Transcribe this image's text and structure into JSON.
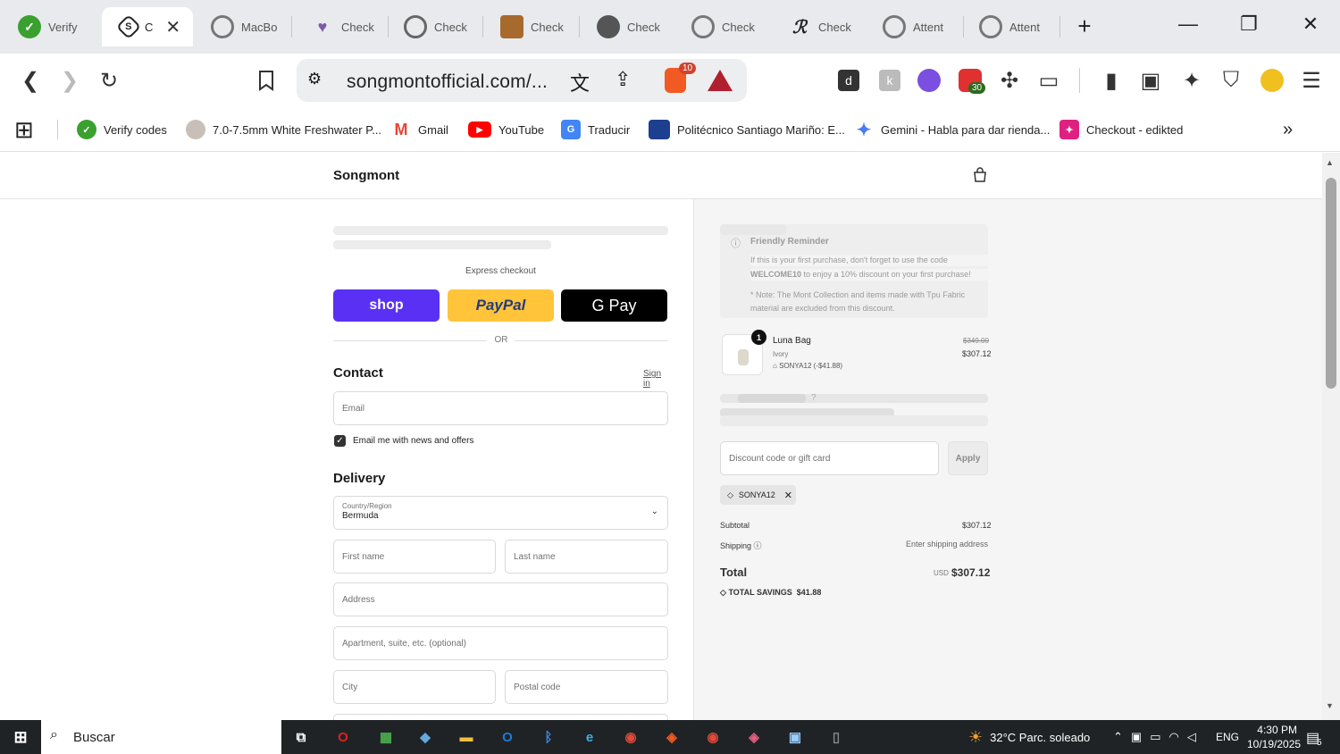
{
  "tabs": [
    {
      "label": "Verify",
      "icon": "verify-icon"
    },
    {
      "label": "C",
      "icon": "compass-icon",
      "active": true
    },
    {
      "label": "MacBo",
      "icon": "globe-icon"
    },
    {
      "label": "Check",
      "icon": "heart-icon"
    },
    {
      "label": "Check",
      "icon": "globe-icon"
    },
    {
      "label": "Check",
      "icon": "bag-icon"
    },
    {
      "label": "Check",
      "icon": "globe-icon"
    },
    {
      "label": "Check",
      "icon": "globe-icon"
    },
    {
      "label": "Check",
      "icon": "signature-icon"
    },
    {
      "label": "Attent",
      "icon": "globe-icon"
    },
    {
      "label": "Attent",
      "icon": "globe-icon"
    }
  ],
  "toolbar": {
    "url": "songmontofficial.com/...",
    "brave_badge": "10",
    "ext_badge": "30"
  },
  "bookmarks": [
    {
      "label": "Verify codes",
      "color": "#3aa030"
    },
    {
      "label": "7.0-7.5mm White Freshwater P...",
      "color": "#b0a8a0"
    },
    {
      "label": "Gmail",
      "color": "#ea4335"
    },
    {
      "label": "YouTube",
      "color": "#ff0000"
    },
    {
      "label": "Traducir",
      "color": "#4285f4"
    },
    {
      "label": "Politécnico Santiago Mariño: E...",
      "color": "#1d3f8f"
    },
    {
      "label": "Gemini - Habla para dar rienda...",
      "color": "#4a7bf0"
    },
    {
      "label": "Checkout - edikted",
      "color": "#e02080"
    }
  ],
  "store": {
    "name": "Songmont",
    "express_checkout": "Express checkout",
    "shop_label": "shop",
    "paypal_label": "PayPal",
    "gpay_label": "G Pay",
    "or": "OR",
    "contact_title": "Contact",
    "sign_in": "Sign in",
    "email_placeholder": "Email",
    "email_news": "Email me with news and offers",
    "delivery_title": "Delivery",
    "country_label": "Country/Region",
    "country_value": "Bermuda",
    "first_name": "First name",
    "last_name": "Last name",
    "address": "Address",
    "apartment": "Apartment, suite, etc. (optional)",
    "city": "City",
    "postal": "Postal code"
  },
  "summary": {
    "reminder_title": "Friendly Reminder",
    "reminder_line1": "If this is your first purchase, don't forget to use the code",
    "reminder_code": "WELCOME10",
    "reminder_line2": " to enjoy a 10% discount on your first purchase!",
    "reminder_note1": "* Note: The Mont Collection and items made with Tpu Fabric",
    "reminder_note2": "material are excluded from this discount.",
    "product_qty": "1",
    "product_name": "Luna Bag",
    "product_variant": "Ivory",
    "product_discount": "SONYA12 (-$41.88)",
    "product_old_price": "$349.00",
    "product_price": "$307.12",
    "discount_placeholder": "Discount code or gift card",
    "apply": "Apply",
    "applied_code": "SONYA12",
    "subtotal_label": "Subtotal",
    "subtotal_value": "$307.12",
    "shipping_label": "Shipping",
    "shipping_value": "Enter shipping address",
    "total_label": "Total",
    "total_currency": "USD",
    "total_value": "$307.12",
    "savings_label": "TOTAL SAVINGS",
    "savings_value": "$41.88"
  },
  "taskbar": {
    "search": "Buscar",
    "weather": "32°C  Parc. soleado",
    "lang": "ENG",
    "time": "4:30 PM",
    "date": "10/19/2025",
    "notif": "5"
  }
}
